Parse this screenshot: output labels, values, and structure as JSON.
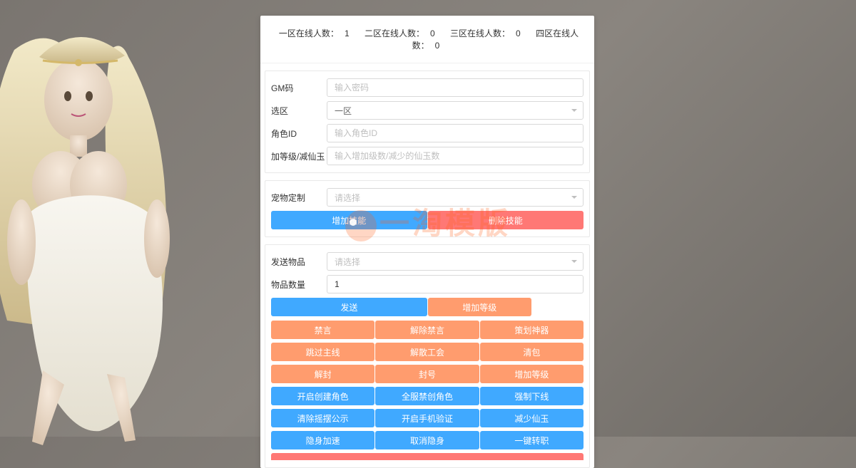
{
  "stats": {
    "zone1_label": "一区在线人数：",
    "zone1_value": "1",
    "zone2_label": "二区在线人数：",
    "zone2_value": "0",
    "zone3_label": "三区在线人数：",
    "zone3_value": "0",
    "zone4_label": "四区在线人数：",
    "zone4_value": "0"
  },
  "labels": {
    "gm_code": "GM码",
    "select_zone": "选区",
    "role_id": "角色ID",
    "level_jade": "加等级/减仙玉",
    "pet_custom": "宠物定制",
    "send_item": "发送物品",
    "item_qty": "物品数量"
  },
  "placeholders": {
    "gm_code": "输入密码",
    "role_id": "输入角色ID",
    "level_jade": "输入增加级数/减少的仙玉数",
    "please_select": "请选择"
  },
  "values": {
    "zone_selected": "一区",
    "item_qty": "1"
  },
  "buttons": {
    "add_skill": "增加技能",
    "del_skill": "删除技能",
    "send": "发送",
    "add_level": "增加等级",
    "ban_chat": "禁言",
    "unban_chat": "解除禁言",
    "plan_artifact": "策划神器",
    "skip_main": "跳过主线",
    "dismiss_guild": "解散工会",
    "clear_bag": "清包",
    "unseal": "解封",
    "seal": "封号",
    "inc_level": "增加等级",
    "open_create": "开启创建角色",
    "global_ban_create": "全服禁创角色",
    "force_offline": "强制下线",
    "clear_roll_notice": "清除摇摆公示",
    "open_phone_verify": "开启手机验证",
    "dec_jade": "减少仙玉",
    "stealth_speed": "隐身加速",
    "cancel_stealth": "取消隐身",
    "onekey_transfer": "一键转职"
  },
  "watermark": "一淘模版"
}
